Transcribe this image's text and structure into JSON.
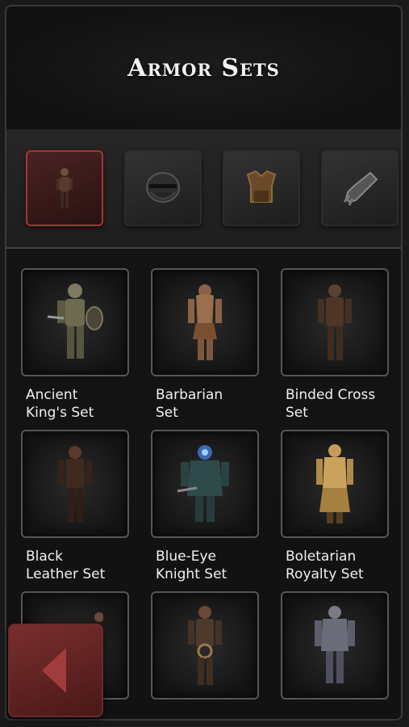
{
  "header": {
    "title": "Armor Sets"
  },
  "tabs": [
    {
      "name": "tab-armor-sets",
      "icon": "knight-figure-icon",
      "selected": true
    },
    {
      "name": "tab-helmets",
      "icon": "helmet-icon",
      "selected": false
    },
    {
      "name": "tab-chest",
      "icon": "chest-armor-icon",
      "selected": false
    },
    {
      "name": "tab-gauntlets",
      "icon": "gauntlet-icon",
      "selected": false
    }
  ],
  "sets": [
    {
      "label": "Ancient\nKing's Set",
      "icon": "knight-figure-icon"
    },
    {
      "label": "Barbarian\nSet",
      "icon": "knight-figure-icon"
    },
    {
      "label": "Binded Cross\nSet",
      "icon": "knight-figure-icon"
    },
    {
      "label": "Black\nLeather Set",
      "icon": "knight-figure-icon"
    },
    {
      "label": "Blue-Eye\nKnight Set",
      "icon": "knight-figure-icon"
    },
    {
      "label": "Boletarian\nRoyalty Set",
      "icon": "knight-figure-icon"
    },
    {
      "label": "",
      "icon": "knight-figure-icon"
    },
    {
      "label": "",
      "icon": "knight-figure-icon"
    },
    {
      "label": "",
      "icon": "knight-figure-icon"
    }
  ],
  "colors": {
    "accent": "#a33333",
    "back_button": "#7a2e2e"
  },
  "back_button": {
    "icon": "back-arrow-icon"
  }
}
